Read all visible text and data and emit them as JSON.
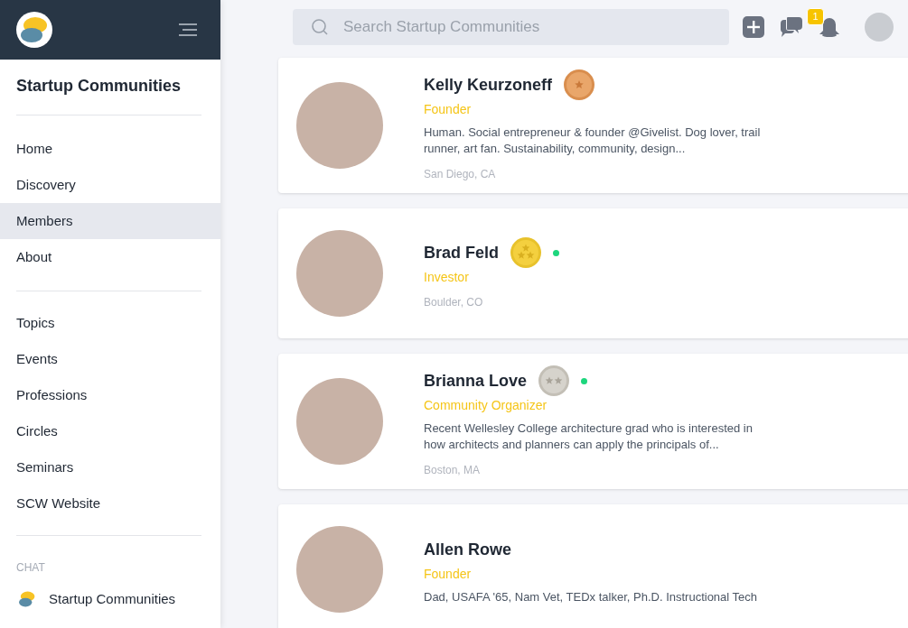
{
  "sidebar": {
    "title": "Startup Communities",
    "nav": [
      {
        "label": "Home",
        "selected": false
      },
      {
        "label": "Discovery",
        "selected": false
      },
      {
        "label": "Members",
        "selected": true
      },
      {
        "label": "About",
        "selected": false
      }
    ],
    "sections": [
      {
        "label": "Topics"
      },
      {
        "label": "Events"
      },
      {
        "label": "Professions"
      },
      {
        "label": "Circles"
      },
      {
        "label": "Seminars"
      },
      {
        "label": "SCW Website"
      }
    ],
    "chat": {
      "heading": "CHAT",
      "items": [
        {
          "label": "Startup Communities"
        }
      ]
    }
  },
  "topbar": {
    "search": {
      "placeholder": "Search Startup Communities"
    },
    "notifications": {
      "count": "1"
    }
  },
  "members": [
    {
      "name": "Kelly Keurzoneff",
      "medal": {
        "kind": "bronze"
      },
      "online": false,
      "role": "Founder",
      "bio": "Human. Social entrepreneur & founder @Givelist. Dog lover, trail runner, art fan. Sustainability, community, design...",
      "location": "San Diego, CA"
    },
    {
      "name": "Brad Feld",
      "medal": {
        "kind": "gold"
      },
      "online": true,
      "role": "Investor",
      "location": "Boulder, CO"
    },
    {
      "name": "Brianna Love",
      "medal": {
        "kind": "silver"
      },
      "online": true,
      "role": "Community Organizer",
      "bio": "Recent Wellesley College architecture grad who is interested in how architects and planners can apply the principals of...",
      "location": "Boston, MA"
    },
    {
      "name": "Allen Rowe",
      "online": false,
      "role": "Founder",
      "bio": "Dad, USAFA '65, Nam Vet, TEDx talker, Ph.D. Instructional Tech"
    }
  ]
}
